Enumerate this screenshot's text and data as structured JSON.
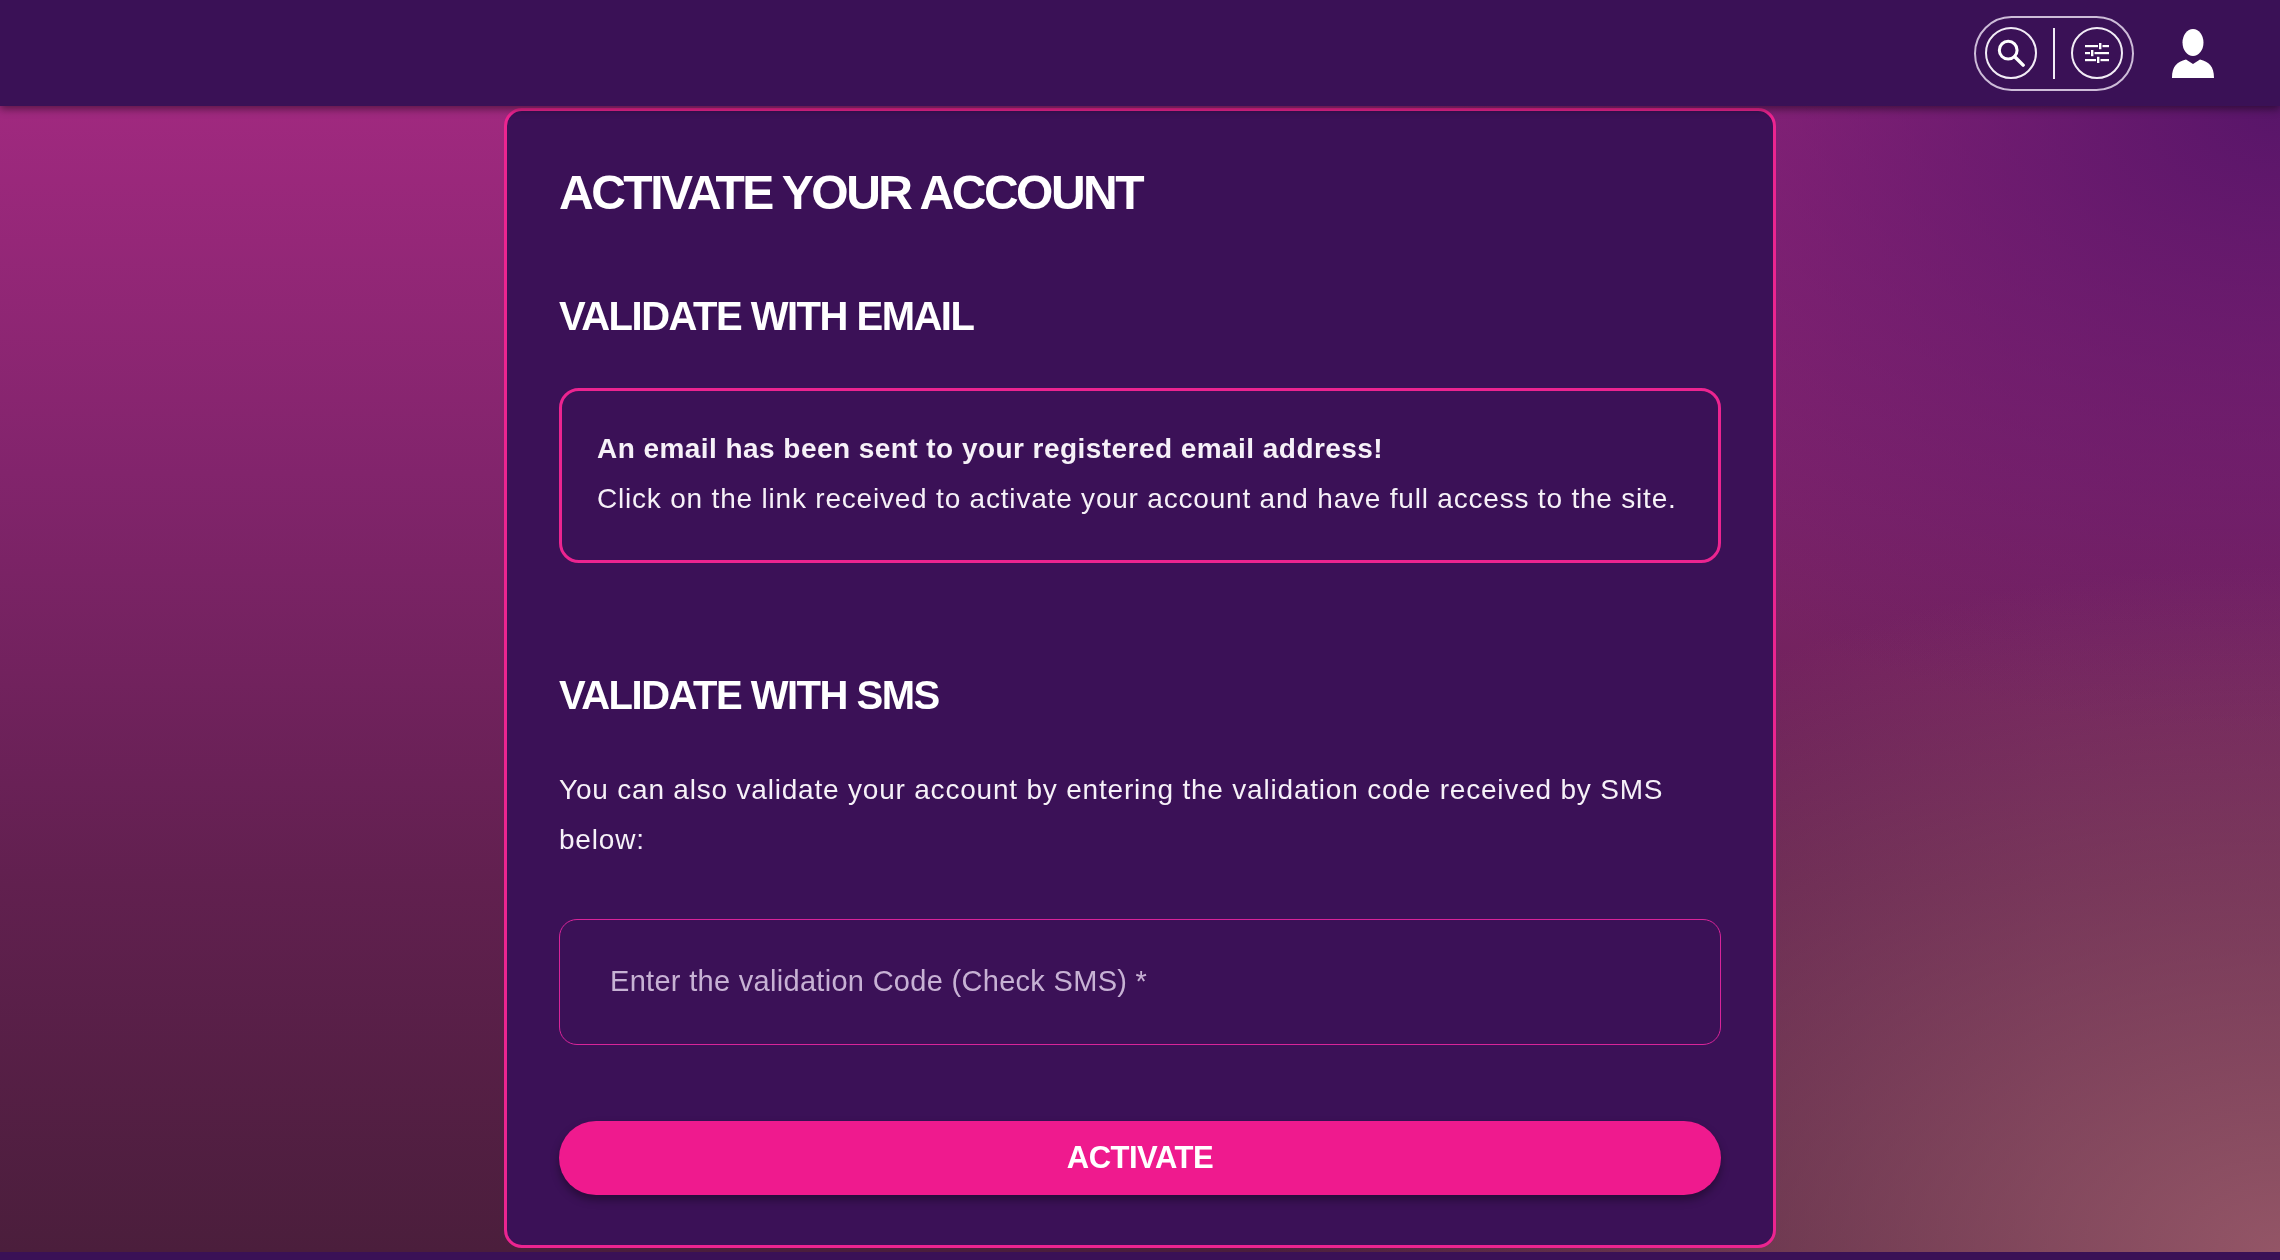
{
  "card": {
    "title": "ACTIVATE YOUR ACCOUNT",
    "sections": [
      {
        "kind": "notice",
        "heading": "VALIDATE WITH EMAIL",
        "notice": {
          "headline": "An email has been sent to your registered email address!",
          "message": "Click on the link received to activate your account and have full access to the site."
        }
      },
      {
        "kind": "form",
        "heading": "VALIDATE WITH SMS",
        "description": "You can also validate your account by entering the validation code received by SMS below:",
        "field": {
          "placeholder": "Enter the validation Code (Check SMS) *"
        },
        "button": "ACTIVATE"
      }
    ]
  }
}
